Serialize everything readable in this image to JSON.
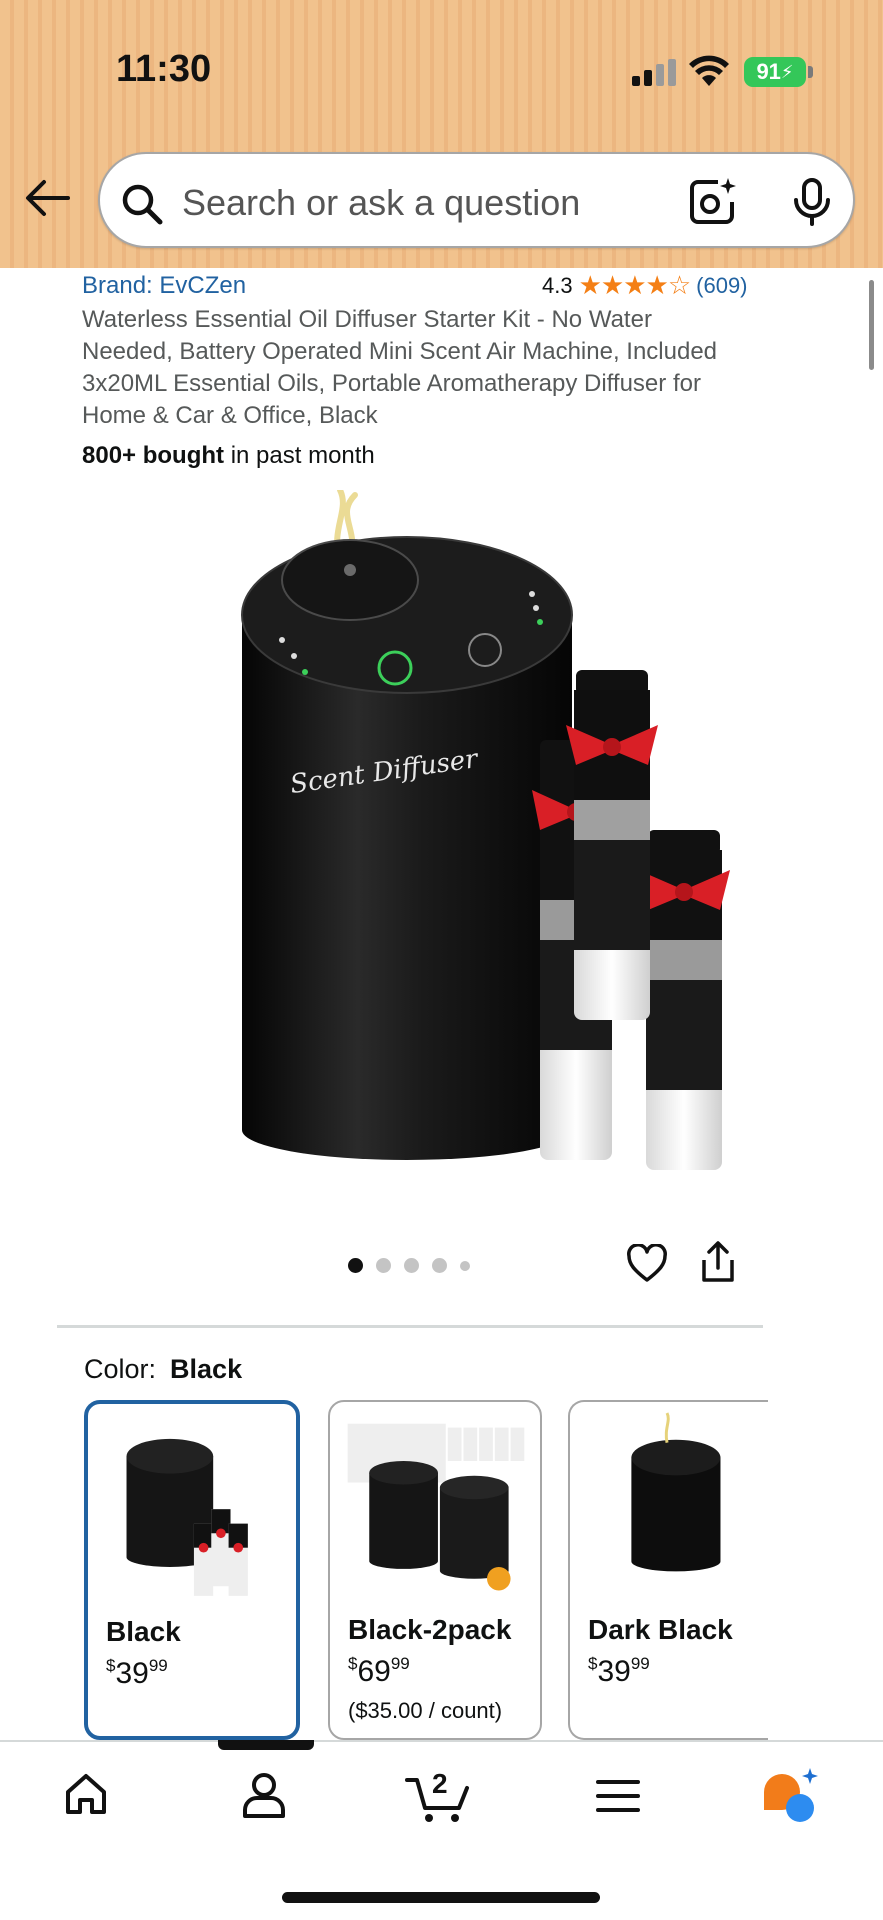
{
  "status_bar": {
    "time": "11:30",
    "battery": "91"
  },
  "search": {
    "placeholder": "Search or ask a question"
  },
  "product": {
    "brand": "Brand: EvCZen",
    "rating": "4.3",
    "stars": "★★★★☆",
    "review_count": "(609)",
    "title": "Waterless Essential Oil Diffuser Starter Kit - No Water Needed, Battery Operated Mini Scent Air Machine, Included 3x20ML Essential Oils, Portable Aromatherapy Diffuser for Home & Car & Office, Black",
    "bought_bold": "800+ bought",
    "bought_rest": " in past month",
    "image_text": "Scent Diffuser",
    "image_count": 5,
    "active_image": 1
  },
  "color": {
    "label": "Color:",
    "selected": "Black",
    "options": [
      {
        "name": "Black",
        "currency": "$",
        "price": "39",
        "cents": "99",
        "per": ""
      },
      {
        "name": "Black-2pack",
        "currency": "$",
        "price": "69",
        "cents": "99",
        "per": "($35.00 / count)"
      },
      {
        "name": "Dark Black",
        "currency": "$",
        "price": "39",
        "cents": "99",
        "per": ""
      }
    ]
  },
  "bottom_nav": {
    "cart_count": "2"
  },
  "colors": {
    "link": "#2162a1",
    "star": "#f47f15",
    "header": "#f1c28d",
    "selected_border": "#2162a1",
    "battery": "#34c759"
  }
}
